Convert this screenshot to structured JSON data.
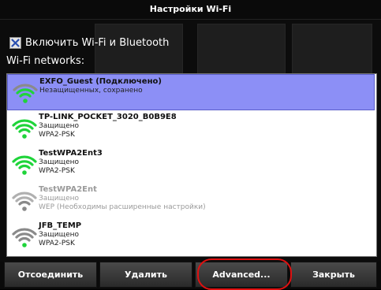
{
  "dialog": {
    "title": "Настройки Wi-Fi"
  },
  "toggle": {
    "label": "Включить Wi-Fi и Bluetooth",
    "checked": true
  },
  "networks_label": "Wi-Fi networks:",
  "networks": [
    {
      "name": "EXFO_Guest (Подключено)",
      "lines": [
        "Незащищенных, сохранено"
      ],
      "signal": "strong",
      "state": "selected",
      "icon": "wifi-signal-icon"
    },
    {
      "name": "TP-LINK_POCKET_3020_B0B9E8",
      "lines": [
        "Защищено",
        "WPA2-PSK"
      ],
      "signal": "strong",
      "state": "normal",
      "icon": "wifi-signal-icon"
    },
    {
      "name": "TestWPA2Ent3",
      "lines": [
        "Защищено",
        "WPA2-PSK"
      ],
      "signal": "strong",
      "state": "normal",
      "icon": "wifi-signal-icon"
    },
    {
      "name": "TestWPA2Ent",
      "lines": [
        "Защищено",
        "WEP (Необходимы расширенные настройки)"
      ],
      "signal": "weak",
      "state": "disabled",
      "icon": "wifi-signal-icon"
    },
    {
      "name": "JFB_TEMP",
      "lines": [
        "Защищено",
        "WPA2-PSK"
      ],
      "signal": "weak",
      "state": "normal",
      "icon": "wifi-signal-icon"
    }
  ],
  "buttons": {
    "disconnect": "Отсоединить",
    "delete": "Удалить",
    "advanced": "Advanced...",
    "close": "Закрыть"
  },
  "colors": {
    "selected_row": "#8c8ff6",
    "signal_green": "#1fd43a",
    "signal_gray": "#8a8a8a",
    "highlight_ring": "#e01010"
  }
}
